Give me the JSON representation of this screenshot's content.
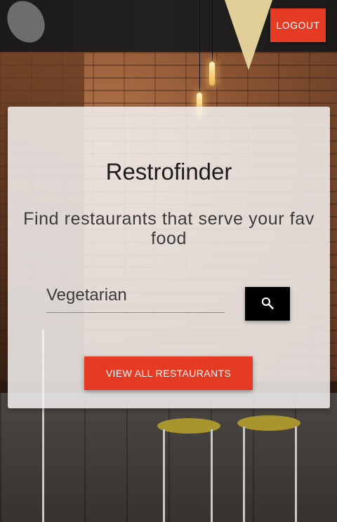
{
  "header": {
    "logout_label": "LOGOUT"
  },
  "main": {
    "title": "Restrofinder",
    "subtitle": "Find restaurants that serve your fav food",
    "search": {
      "value": "Vegetarian",
      "placeholder": ""
    },
    "search_icon": "search-icon",
    "view_all_label": "VIEW ALL RESTAURANTS"
  },
  "colors": {
    "accent": "#e53a24",
    "search_button": "#000000",
    "card_bg": "#f3f1f0"
  }
}
